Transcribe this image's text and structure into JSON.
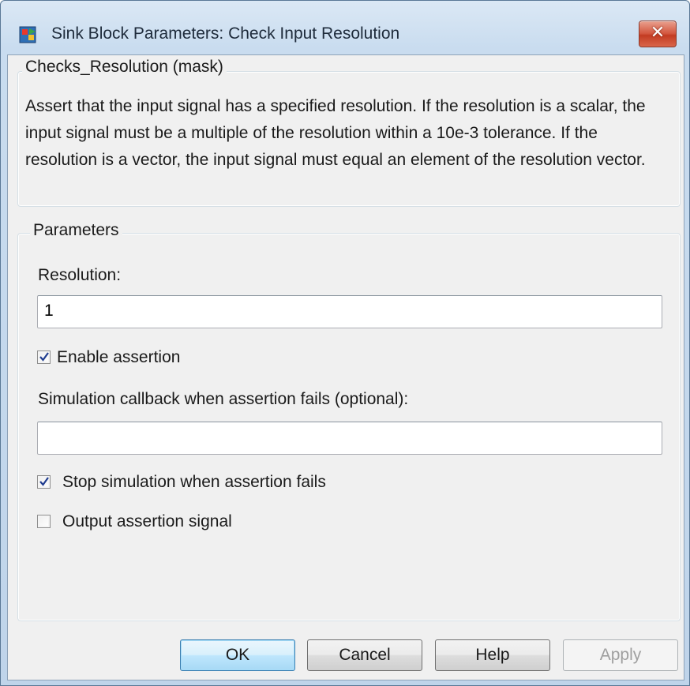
{
  "window": {
    "title": "Sink Block Parameters: Check Input Resolution",
    "close_symbol": "✕"
  },
  "mask_group": {
    "legend": "Checks_Resolution (mask)",
    "description": "Assert that the input signal has a specified resolution.  If the resolution is a scalar, the input signal must be a multiple of the resolution within a 10e-3 tolerance.  If the resolution is a vector, the input signal must equal an element of the resolution vector."
  },
  "parameters_group": {
    "legend": "Parameters",
    "resolution_label": "Resolution:",
    "resolution_value": "1",
    "enable_assertion": {
      "label": "Enable assertion",
      "checked": true
    },
    "callback_label": "Simulation callback when assertion fails (optional):",
    "callback_value": "",
    "stop_simulation": {
      "label": "Stop simulation when assertion fails",
      "checked": true
    },
    "output_signal": {
      "label": "Output assertion signal",
      "checked": false
    }
  },
  "buttons": {
    "ok": "OK",
    "cancel": "Cancel",
    "help": "Help",
    "apply": "Apply"
  },
  "icons": {
    "app": "simulink-block-icon",
    "close": "close-icon",
    "check": "checkmark-icon"
  }
}
